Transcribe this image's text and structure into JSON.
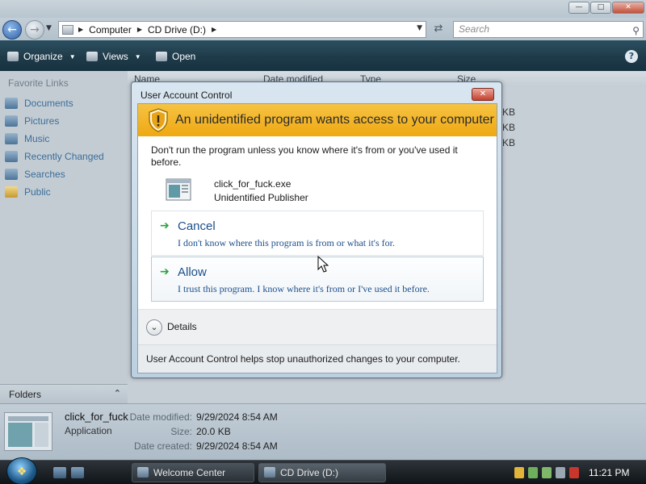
{
  "explorer": {
    "address": {
      "crumbs": [
        "Computer",
        "CD Drive (D:)"
      ]
    },
    "search": {
      "placeholder": "Search"
    },
    "toolbar": {
      "organize": "Organize",
      "views": "Views",
      "open": "Open"
    },
    "columns": [
      "Name",
      "Date modified",
      "Type",
      "Size"
    ],
    "size_fragments": [
      "KB",
      "KB",
      "KB"
    ],
    "nav": {
      "heading": "Favorite Links",
      "items": [
        {
          "label": "Documents",
          "icon": "documents-icon"
        },
        {
          "label": "Pictures",
          "icon": "pictures-icon"
        },
        {
          "label": "Music",
          "icon": "music-icon"
        },
        {
          "label": "Recently Changed",
          "icon": "recently-changed-icon"
        },
        {
          "label": "Searches",
          "icon": "searches-icon"
        },
        {
          "label": "Public",
          "icon": "public-folder-icon"
        }
      ],
      "folders_label": "Folders"
    },
    "details_pane": {
      "name": "click_for_fuck",
      "type": "Application",
      "modified_label": "Date modified:",
      "modified": "9/29/2024 8:54 AM",
      "size_label": "Size:",
      "size": "20.0 KB",
      "created_label": "Date created:",
      "created": "9/29/2024 8:54 AM"
    }
  },
  "uac": {
    "title": "User Account Control",
    "banner": "An unidentified program wants access to your computer",
    "warning": "Don't run the program unless you know where it's from or you've used it before.",
    "program_name": "click_for_fuck.exe",
    "publisher": "Unidentified Publisher",
    "cancel": {
      "title": "Cancel",
      "desc": "I don't know where this program is from or what it's for."
    },
    "allow": {
      "title": "Allow",
      "desc": "I trust this program. I know where it's from or I've used it before."
    },
    "details_label": "Details",
    "footer": "User Account Control helps stop unauthorized changes to your computer."
  },
  "taskbar": {
    "tasks": [
      "Welcome Center",
      "CD Drive (D:)"
    ],
    "clock": "11:21 PM"
  },
  "colors": {
    "uac_banner": "#f6c342",
    "toolbar": "#1f3b4a",
    "link_blue": "#1d4f8c",
    "allow_arrow": "#27a33a"
  }
}
